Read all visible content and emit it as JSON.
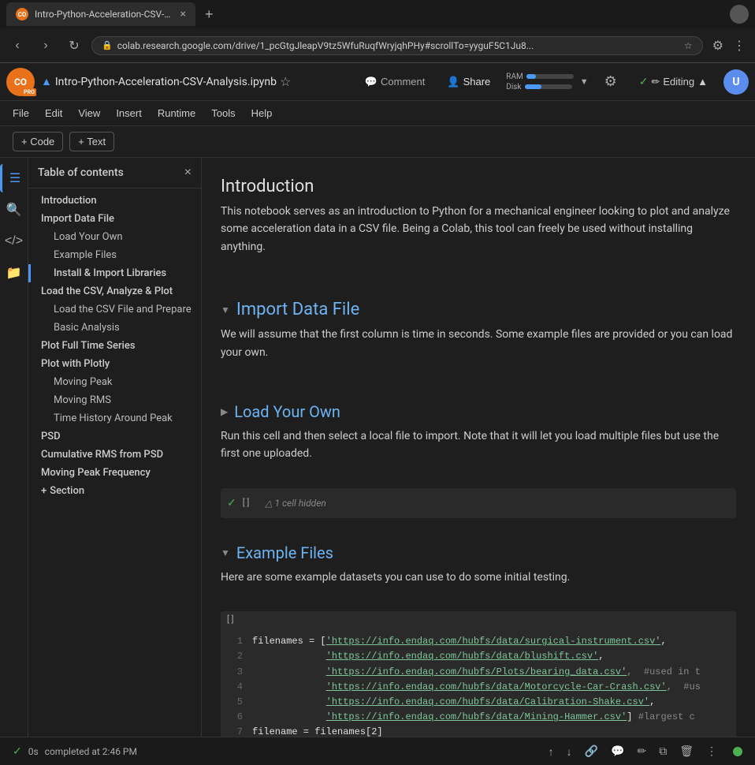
{
  "browser": {
    "tab": {
      "favicon": "CO",
      "title": "Intro-Python-Acceleration-CSV-A...",
      "close": "×"
    },
    "new_tab": "+",
    "address": {
      "lock": "🔒",
      "url": "colab.research.google.com/drive/1_pcGtgJleapV9tz5WfuRuqfWryjqhPHy#scrollTo=yyguF5C1Ju8...",
      "star": "★",
      "extensions": "..."
    },
    "nav": {
      "back": "‹",
      "forward": "›",
      "refresh": "↻"
    }
  },
  "app_header": {
    "logo": "CO",
    "pro": "PRO",
    "drive_icon": "📁",
    "file_name": "Intro-Python-Acceleration-CSV-Analysis.ipynb",
    "star": "☆",
    "comment_label": "Comment",
    "share_label": "Share",
    "settings_icon": "⚙",
    "ram_label": "RAM",
    "disk_label": "Disk",
    "editing_label": "Editing",
    "checkmark": "✓"
  },
  "menu": {
    "items": [
      "File",
      "Edit",
      "View",
      "Insert",
      "Runtime",
      "Tools",
      "Help"
    ]
  },
  "toolbar": {
    "code_btn": "+ Code",
    "text_btn": "+ Text"
  },
  "sidebar": {
    "title": "Table of contents",
    "close": "×",
    "toc": [
      {
        "label": "Introduction",
        "level": 1,
        "active": false
      },
      {
        "label": "Import Data File",
        "level": 1,
        "active": false
      },
      {
        "label": "Load Your Own",
        "level": 2,
        "active": false
      },
      {
        "label": "Example Files",
        "level": 2,
        "active": false
      },
      {
        "label": "Install & Import Libraries",
        "level": 1,
        "active": true
      },
      {
        "label": "Load the CSV, Analyze & Plot",
        "level": 1,
        "active": false
      },
      {
        "label": "Load the CSV File and Prepare",
        "level": 2,
        "active": false
      },
      {
        "label": "Basic Analysis",
        "level": 2,
        "active": false
      },
      {
        "label": "Plot Full Time Series",
        "level": 1,
        "active": false
      },
      {
        "label": "Plot with Plotly",
        "level": 1,
        "active": false
      },
      {
        "label": "Moving Peak",
        "level": 2,
        "active": false
      },
      {
        "label": "Moving RMS",
        "level": 2,
        "active": false
      },
      {
        "label": "Time History Around Peak",
        "level": 2,
        "active": false
      },
      {
        "label": "PSD",
        "level": 1,
        "active": false
      },
      {
        "label": "Cumulative RMS from PSD",
        "level": 1,
        "active": false
      },
      {
        "label": "Moving Peak Frequency",
        "level": 1,
        "active": false
      },
      {
        "label": "Section",
        "level": 1,
        "active": false
      }
    ],
    "section_plus": "+"
  },
  "sidebar_icons": {
    "search": "🔍",
    "code": "</>",
    "folder": "📁",
    "active": 0
  },
  "notebook": {
    "intro_heading": "Introduction",
    "intro_para": "This notebook serves as an introduction to Python for a mechanical engineer looking to plot and analyze some acceleration data in a CSV file. Being a Colab, this tool can freely be used without installing anything.",
    "import_heading": "Import Data File",
    "import_para": "We will assume that the first column is time in seconds. Some example files are provided or you can load your own.",
    "load_your_own_heading": "Load Your Own",
    "load_your_own_para": "Run this cell and then select a local file to import. Note that it will let you load multiple files but use the first one uploaded.",
    "cell_hidden_label": "△ 1 cell hidden",
    "cell_bracket": "[ ]",
    "example_files_heading": "Example Files",
    "example_files_para": "Here are some example datasets you can use to do some initial testing.",
    "code": {
      "bracket": "[ ]",
      "line_num_1": "1",
      "line_num_2": "2",
      "line_num_3": "3",
      "line_num_4": "4",
      "line_num_5": "5",
      "line_num_6": "6",
      "line_num_7": "7",
      "line1": "filenames = ['https://info.endaq.com/hubfs/data/surgical-instrument.csv',",
      "line2": "             'https://info.endaq.com/hubfs/data/blushift.csv',",
      "line3": "             'https://info.endaq.com/hubfs/Plots/bearing_data.csv',  #used in t",
      "line4": "             'https://info.endaq.com/hubfs/data/Motorcycle-Car-Crash.csv',  #us",
      "line5": "             'https://info.endaq.com/hubfs/data/Calibration-Shake.csv',",
      "line6": "             'https://info.endaq.com/hubfs/data/Mining-Hammer.csv'] #largest c",
      "line7": "filename = filenames[2]"
    }
  },
  "bottom_bar": {
    "checkmark": "✓",
    "time": "0s",
    "completed": "completed at 2:46 PM",
    "status_dot_color": "#4caf50"
  },
  "cell_toolbar_icons": [
    "↑",
    "↓",
    "🔗",
    "💬",
    "✏",
    "⧉",
    "🗑",
    "⋮"
  ]
}
